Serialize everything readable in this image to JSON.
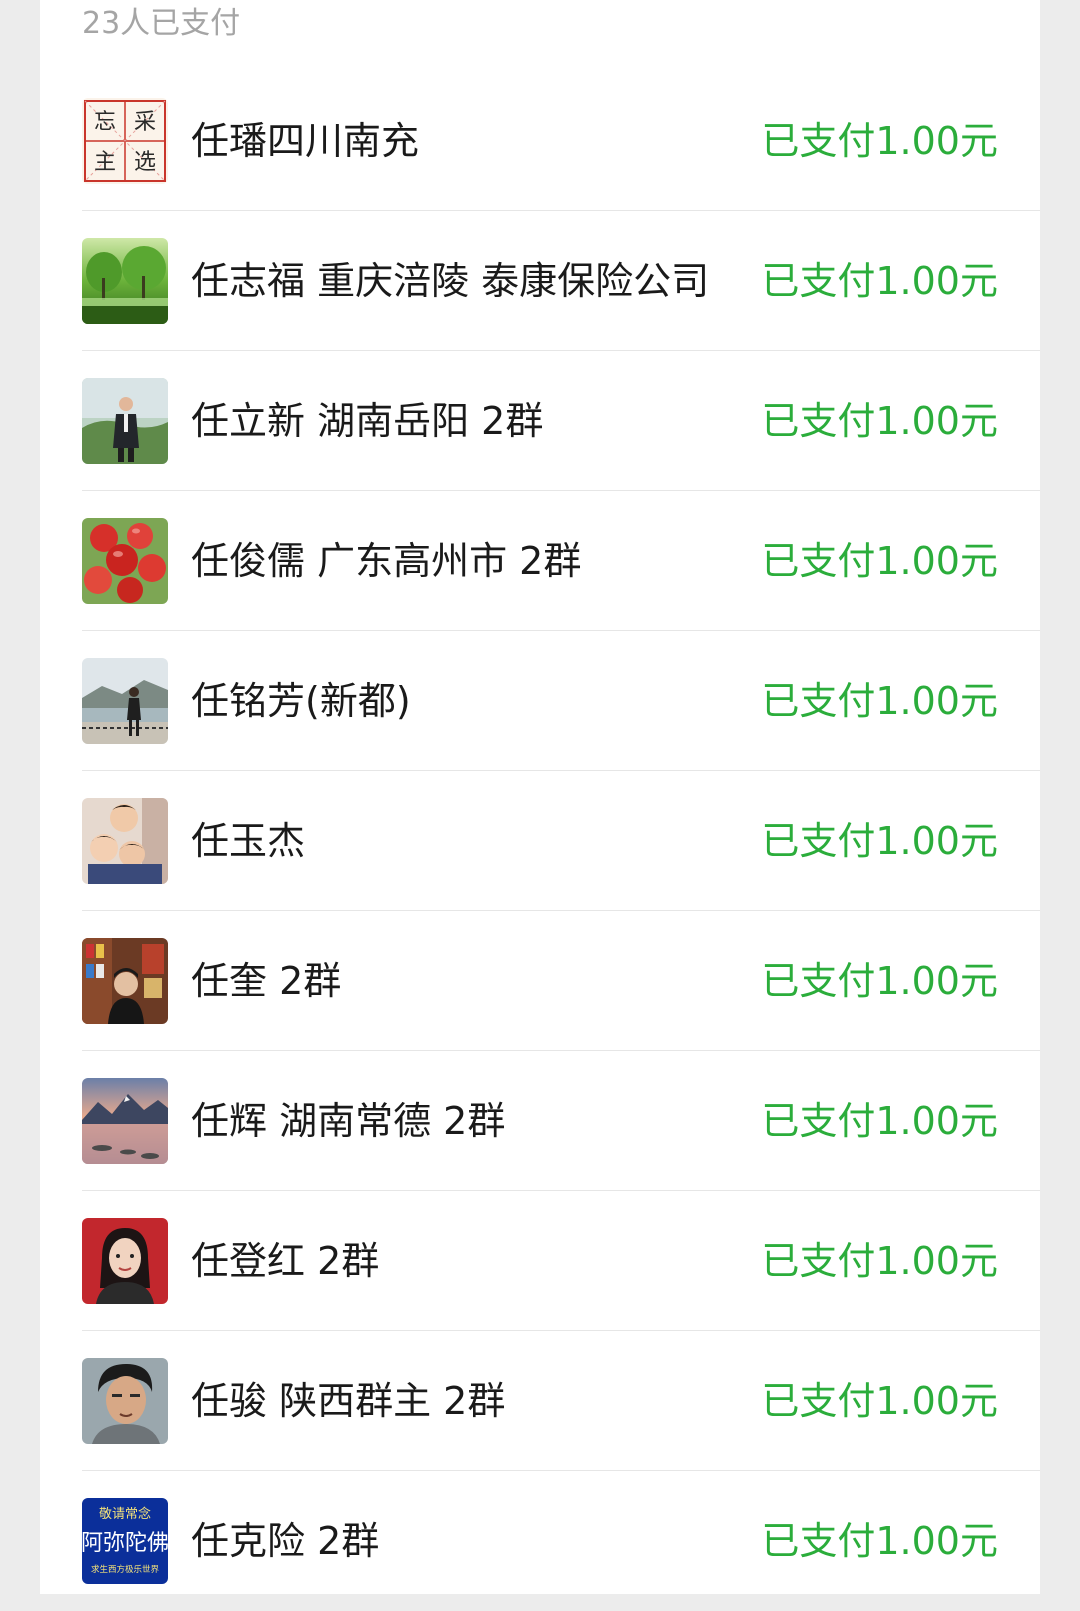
{
  "header": {
    "paid_count_label": "23人已支付"
  },
  "colors": {
    "status_green": "#2bad3b",
    "summary_gray": "#a5a5a5"
  },
  "payments": [
    {
      "name": "任璠四川南充",
      "status": "已支付1.00元",
      "avatar": "calligraphy-grid-avatar"
    },
    {
      "name": "任志福 重庆涪陵 泰康保险公司",
      "status": "已支付1.00元",
      "avatar": "green-forest-avatar"
    },
    {
      "name": "任立新 湖南岳阳 2群",
      "status": "已支付1.00元",
      "avatar": "man-outdoors-avatar"
    },
    {
      "name": "任俊儒 广东高州市 2群",
      "status": "已支付1.00元",
      "avatar": "red-apples-avatar"
    },
    {
      "name": "任铭芳(新都)",
      "status": "已支付1.00元",
      "avatar": "riverside-person-avatar"
    },
    {
      "name": "任玉杰",
      "status": "已支付1.00元",
      "avatar": "children-photo-avatar"
    },
    {
      "name": "任奎 2群",
      "status": "已支付1.00元",
      "avatar": "shop-shelf-avatar"
    },
    {
      "name": "任辉 湖南常德 2群",
      "status": "已支付1.00元",
      "avatar": "mountain-lake-avatar"
    },
    {
      "name": "任登红 2群",
      "status": "已支付1.00元",
      "avatar": "woman-portrait-avatar"
    },
    {
      "name": "任骏 陕西群主 2群",
      "status": "已支付1.00元",
      "avatar": "man-portrait-avatar"
    },
    {
      "name": "任克险 2群",
      "status": "已支付1.00元",
      "avatar": "buddhist-text-avatar"
    }
  ],
  "avatar_texts": {
    "calligraphy": [
      "忘",
      "采",
      "主",
      "选"
    ],
    "buddhist_top": "敬请常念",
    "buddhist_main": "阿弥陀佛",
    "buddhist_bottom": "求生西方极乐世界"
  }
}
